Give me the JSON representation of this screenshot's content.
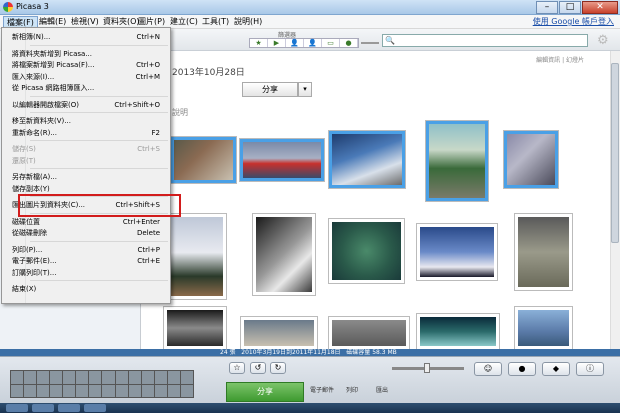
{
  "window": {
    "title": "Picasa 3",
    "minimize": "–",
    "maximize": "□",
    "close": "✕"
  },
  "menubar": {
    "items": [
      "檔案(F)",
      "編輯(E)",
      "檢視(V)",
      "資料夾(O)",
      "圖片(P)",
      "建立(C)",
      "工具(T)",
      "說明(H)"
    ],
    "google_link": "使用 Google 帳戶登入"
  },
  "toolbar": {
    "filter_label": "篩選器",
    "filter_icons": [
      "★",
      "▶",
      "👤",
      "👤",
      "▭",
      "●"
    ],
    "search_placeholder": ""
  },
  "album": {
    "date": "2013年10月28日",
    "edit_link": "編輯資訊 | 幻燈片",
    "share": "分享",
    "description_label": "說明"
  },
  "file_menu": {
    "items": [
      {
        "label": "新相簿(N)...",
        "shortcut": "Ctrl+N",
        "disabled": false
      },
      {
        "sep": true
      },
      {
        "label": "將資料夾新增到 Picasa...",
        "shortcut": "",
        "disabled": false
      },
      {
        "label": "將檔案新增到 Picasa(F)...",
        "shortcut": "Ctrl+O",
        "disabled": false
      },
      {
        "label": "匯入來源(I)...",
        "shortcut": "Ctrl+M",
        "disabled": false
      },
      {
        "label": "從 Picasa 網路相簿匯入...",
        "shortcut": "",
        "disabled": false
      },
      {
        "sep": true
      },
      {
        "label": "以編輯器開啟檔案(O)",
        "shortcut": "Ctrl+Shift+O",
        "disabled": false
      },
      {
        "sep": true
      },
      {
        "label": "移至新資料夾(V)...",
        "shortcut": "",
        "disabled": false
      },
      {
        "label": "重新命名(R)...",
        "shortcut": "F2",
        "disabled": false
      },
      {
        "sep": true
      },
      {
        "label": "儲存(S)",
        "shortcut": "Ctrl+S",
        "disabled": true
      },
      {
        "label": "還原(T)",
        "shortcut": "",
        "disabled": true
      },
      {
        "sep": true
      },
      {
        "label": "另存新檔(A)...",
        "shortcut": "",
        "disabled": false
      },
      {
        "label": "儲存副本(Y)",
        "shortcut": "",
        "disabled": false
      },
      {
        "sep": true
      },
      {
        "label": "匯出圖片到資料夾(C)...",
        "shortcut": "Ctrl+Shift+S",
        "disabled": false
      },
      {
        "sep": true
      },
      {
        "label": "磁碟位置",
        "shortcut": "Ctrl+Enter",
        "disabled": false
      },
      {
        "label": "從磁碟刪除",
        "shortcut": "Delete",
        "disabled": false
      },
      {
        "sep": true
      },
      {
        "label": "列印(P)...",
        "shortcut": "Ctrl+P",
        "disabled": false
      },
      {
        "label": "電子郵件(E)...",
        "shortcut": "Ctrl+E",
        "disabled": false
      },
      {
        "label": "訂購列印(T)...",
        "shortcut": "",
        "disabled": false
      },
      {
        "sep": true
      },
      {
        "label": "結束(X)",
        "shortcut": "",
        "disabled": false
      }
    ]
  },
  "status": {
    "count": "24 張",
    "dates": "2010年3月19日到2011年11月18日",
    "size": "磁碟容量 58.3 MB"
  },
  "bottom": {
    "share": "分享",
    "email": "電子郵件",
    "print": "列印",
    "export": "匯出"
  },
  "colors": {
    "selection": "#4aa0e6",
    "highlight": "#d21c1c",
    "share_green": "#3e9a30"
  }
}
